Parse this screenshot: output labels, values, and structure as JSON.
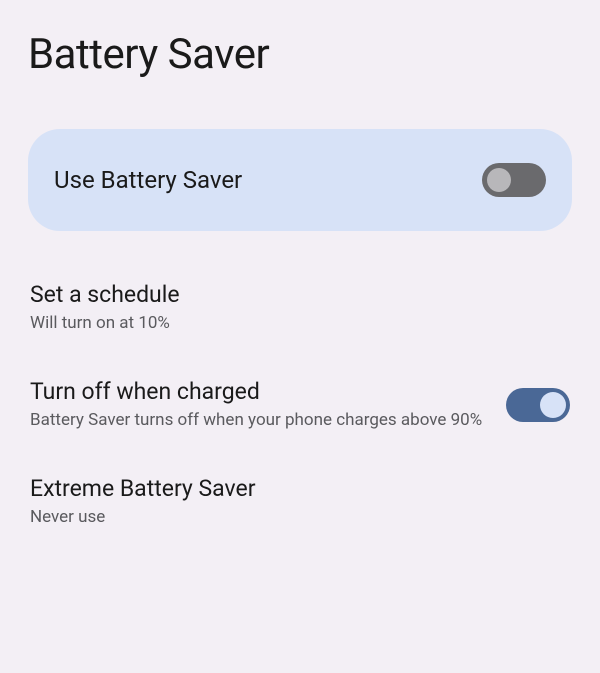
{
  "page": {
    "title": "Battery Saver"
  },
  "mainToggle": {
    "label": "Use Battery Saver",
    "enabled": false
  },
  "settings": [
    {
      "title": "Set a schedule",
      "subtitle": "Will turn on at 10%",
      "hasToggle": false
    },
    {
      "title": "Turn off when charged",
      "subtitle": "Battery Saver turns off when your phone charges above 90%",
      "hasToggle": true,
      "enabled": true
    },
    {
      "title": "Extreme Battery Saver",
      "subtitle": "Never use",
      "hasToggle": false
    }
  ]
}
